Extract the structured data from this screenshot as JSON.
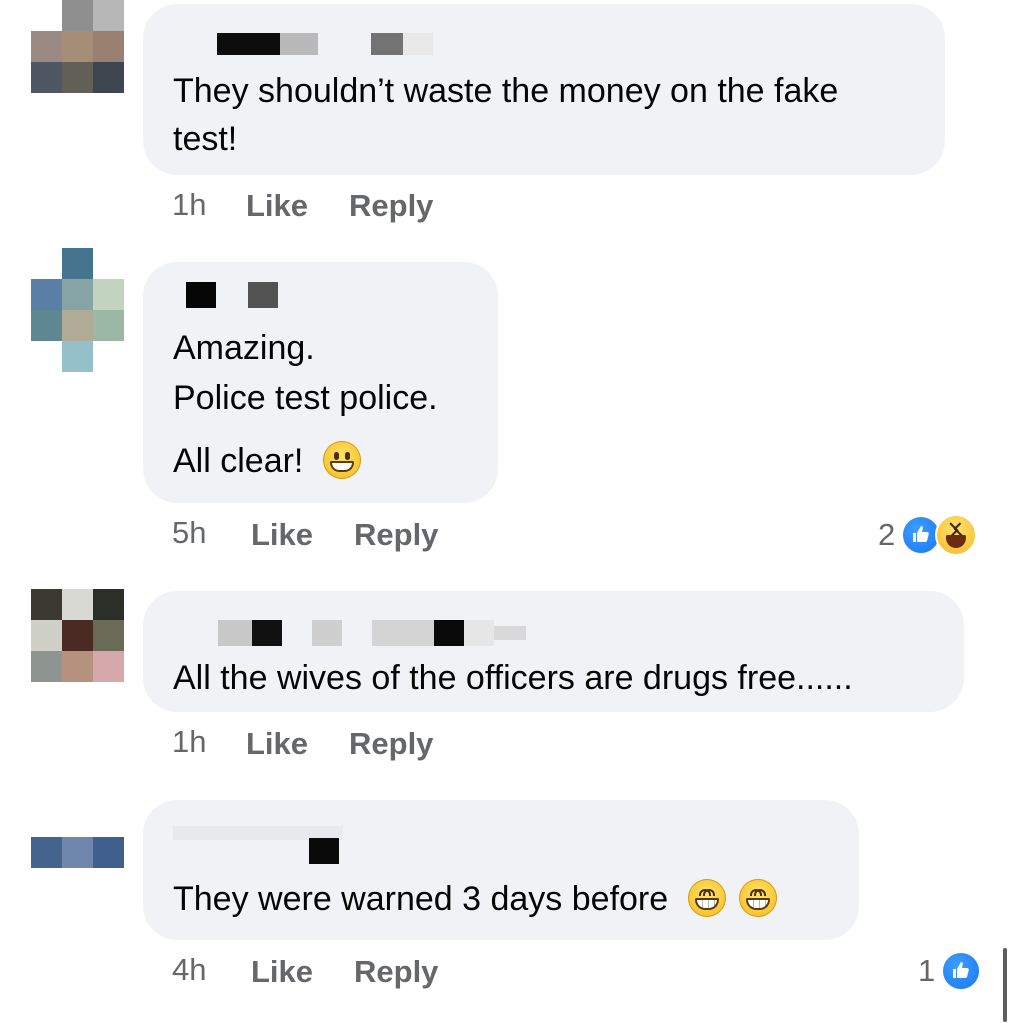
{
  "comments": [
    {
      "text_lines": [
        "They shouldn’t waste the money on the fake",
        "test!"
      ],
      "time": "1h",
      "like_label": "Like",
      "reply_label": "Reply"
    },
    {
      "text_lines": [
        "Amazing.",
        "Police test police.",
        "All clear!"
      ],
      "emoji": "grinning-face",
      "time": "5h",
      "like_label": "Like",
      "reply_label": "Reply",
      "reaction_count": "2",
      "reaction_icons": [
        "like-icon",
        "haha-icon"
      ]
    },
    {
      "text_lines": [
        "All the wives of the officers are drugs free......"
      ],
      "time": "1h",
      "like_label": "Like",
      "reply_label": "Reply"
    },
    {
      "text_lines": [
        "They were warned 3 days before"
      ],
      "emoji": [
        "beaming-face",
        "beaming-face"
      ],
      "time": "4h",
      "like_label": "Like",
      "reply_label": "Reply",
      "reaction_count": "1",
      "reaction_icons": [
        "like-icon"
      ]
    }
  ],
  "colors": {
    "bubble": "#f0f2f5",
    "meta_text": "#65676b",
    "like_blue": "#1877f2"
  }
}
